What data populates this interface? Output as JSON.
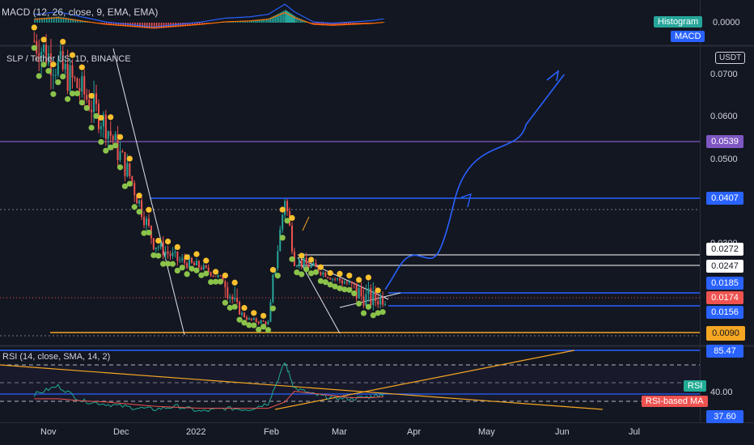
{
  "macd": {
    "legend": "MACD (12, 26, close, 9, EMA, EMA)",
    "value": "0.0000",
    "histogram_badge": "Histogram",
    "macd_badge": "MACD"
  },
  "main": {
    "legend": "SLP / Tether US, 1D, BINANCE",
    "currency": "USDT",
    "axis_ticks": [
      "0.0700",
      "0.0600",
      "0.0500",
      "0.0300"
    ],
    "price_labels": [
      {
        "value": "0.0539",
        "color": "#7e57c2"
      },
      {
        "value": "0.0407",
        "color": "#2962ff"
      },
      {
        "value": "0.0272",
        "color": "#ffffff"
      },
      {
        "value": "0.0247",
        "color": "#ffffff"
      },
      {
        "value": "0.0185",
        "color": "#2962ff"
      },
      {
        "value": "0.0174",
        "color": "#ef5350"
      },
      {
        "value": "0.0156",
        "color": "#2962ff"
      },
      {
        "value": "0.0090",
        "color": "#f5a623"
      }
    ]
  },
  "rsi": {
    "legend": "RSI (14, close, SMA, 14, 2)",
    "rsi_badge": "RSI",
    "ma_badge": "RSI-based MA",
    "ticks": [
      "85.47",
      "40.00",
      "37.60"
    ]
  },
  "x_axis": [
    "Nov",
    "Dec",
    "2022",
    "Feb",
    "Mar",
    "Apr",
    "May",
    "Jun",
    "Jul"
  ],
  "chart_data": [
    {
      "type": "line",
      "title": "SLP / Tether US, 1D, BINANCE",
      "x_unit": "date",
      "x": [
        "2021-10-26",
        "2021-11-05",
        "2021-11-15",
        "2021-11-25",
        "2021-12-05",
        "2021-12-15",
        "2021-12-25",
        "2022-01-04",
        "2022-01-14",
        "2022-01-24",
        "2022-02-01",
        "2022-02-08",
        "2022-02-12",
        "2022-02-20",
        "2022-02-28",
        "2022-03-08",
        "2022-03-16",
        "2022-03-22"
      ],
      "series": [
        {
          "values": [
            0.078,
            0.072,
            0.066,
            0.058,
            0.046,
            0.03,
            0.026,
            0.024,
            0.019,
            0.013,
            0.012,
            0.041,
            0.026,
            0.024,
            0.02,
            0.018,
            0.017,
            0.0174
          ]
        }
      ],
      "ylim": [
        0.008,
        0.079
      ],
      "levels": [
        0.0539,
        0.0407,
        0.0272,
        0.0247,
        0.0185,
        0.0156,
        0.009
      ],
      "projection": {
        "x": [
          "2022-03-22",
          "2022-04-05",
          "2022-04-20",
          "2022-05-20",
          "2022-06-05"
        ],
        "values": [
          0.018,
          0.027,
          0.04,
          0.058,
          0.07
        ]
      }
    },
    {
      "type": "bar",
      "title": "MACD (12, 26, close, 9, EMA, EMA)",
      "values": [
        0.002,
        0.003,
        0.001,
        -0.001,
        -0.002,
        -0.003,
        -0.002,
        -0.001,
        0.0005,
        0.001,
        0.002,
        0.006,
        0.003,
        -0.001,
        -0.0015,
        -0.001,
        -0.0005,
        0.0003
      ]
    },
    {
      "type": "line",
      "title": "RSI (14, close, SMA, 14, 2)",
      "series": [
        {
          "name": "RSI",
          "values": [
            44,
            52,
            38,
            35,
            32,
            30,
            33,
            28,
            31,
            30,
            36,
            74,
            50,
            44,
            41,
            40,
            42,
            45
          ]
        },
        {
          "name": "RSI-based MA",
          "values": [
            40,
            40,
            38,
            37,
            35,
            33,
            32,
            31,
            31,
            31,
            31,
            37,
            47,
            45,
            43,
            41,
            41,
            42
          ]
        }
      ],
      "levels": [
        85.47,
        40.0,
        37.6
      ]
    }
  ]
}
